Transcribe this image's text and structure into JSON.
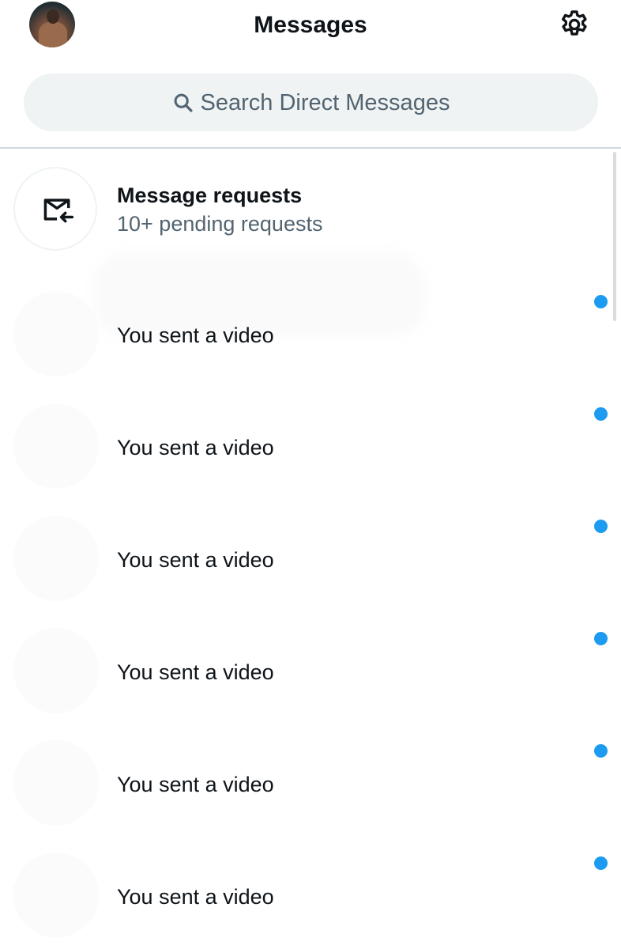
{
  "header": {
    "title": "Messages",
    "avatar_icon": "profile-avatar",
    "settings_icon": "gear-icon"
  },
  "search": {
    "placeholder": "Search Direct Messages",
    "icon": "search-icon"
  },
  "requests": {
    "title": "Message requests",
    "subtitle": "10+ pending requests",
    "icon": "envelope-incoming-icon"
  },
  "conversations": [
    {
      "preview": "You sent a video",
      "unread": true
    },
    {
      "preview": "You sent a video",
      "unread": true
    },
    {
      "preview": "You sent a video",
      "unread": true
    },
    {
      "preview": "You sent a video",
      "unread": true
    },
    {
      "preview": "You sent a video",
      "unread": true
    },
    {
      "preview": "You sent a video",
      "unread": true
    }
  ],
  "colors": {
    "accent": "#1d9bf0",
    "text_primary": "#0f1419",
    "text_secondary": "#536471",
    "search_bg": "#eff3f4"
  }
}
